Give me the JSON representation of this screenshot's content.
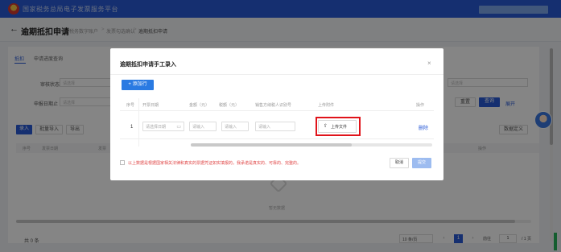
{
  "app": {
    "title": "国家税务总局电子发票服务平台"
  },
  "colors": {
    "brand": "#2a5bd7",
    "highlight": "#e0131a",
    "declaration": "#e04848"
  },
  "header": {
    "back_icon": "arrow-left-icon",
    "title": "逾期抵扣申请",
    "breadcrumbs": [
      "税务数字账户",
      "发票勾选确认",
      "逾期抵扣申请"
    ],
    "separator": ">"
  },
  "background": {
    "tabs": [
      "抵扣",
      "申请进度查询"
    ],
    "filters": [
      {
        "label": "审核状态",
        "placeholder": "请选择"
      },
      {
        "label": "申报日期止",
        "placeholder": "请选择"
      }
    ],
    "right_placeholder": "请选择",
    "buttons": {
      "reset": "重置",
      "query": "查询",
      "expand": "展开"
    },
    "actions": [
      "录入",
      "批量导入",
      "导出"
    ],
    "custom_btn": "数据定义",
    "table_headers": [
      "序号",
      "发票日期",
      "发票",
      "操作"
    ],
    "empty_text": "暂无数据",
    "total": "共 0 条",
    "pager": {
      "page_size": "10 条/页",
      "current": "1",
      "goto_label": "前往",
      "goto_value": "1",
      "total_pages": "/ 1 页"
    }
  },
  "modal": {
    "title": "逾期抵扣申请手工录入",
    "close_icon": "close-icon",
    "add_row": "+ 添加行",
    "columns": [
      "序号",
      "开票日期",
      "金额（元）",
      "税额（元）",
      "销售方纳税人识别号",
      "上传附件",
      "操作"
    ],
    "row": {
      "index": "1",
      "date_placeholder": "请选择日期",
      "amount_placeholder": "请输入",
      "tax_placeholder": "请输入",
      "seller_placeholder": "请输入",
      "upload_label": "上传文件",
      "delete_label": "删除"
    },
    "declaration": "以上数据是根据国家相关法律和真实的票据凭证如实填报的，我承诺是真实的、可靠的、完整的。",
    "cancel": "取消",
    "confirm": "提交"
  }
}
